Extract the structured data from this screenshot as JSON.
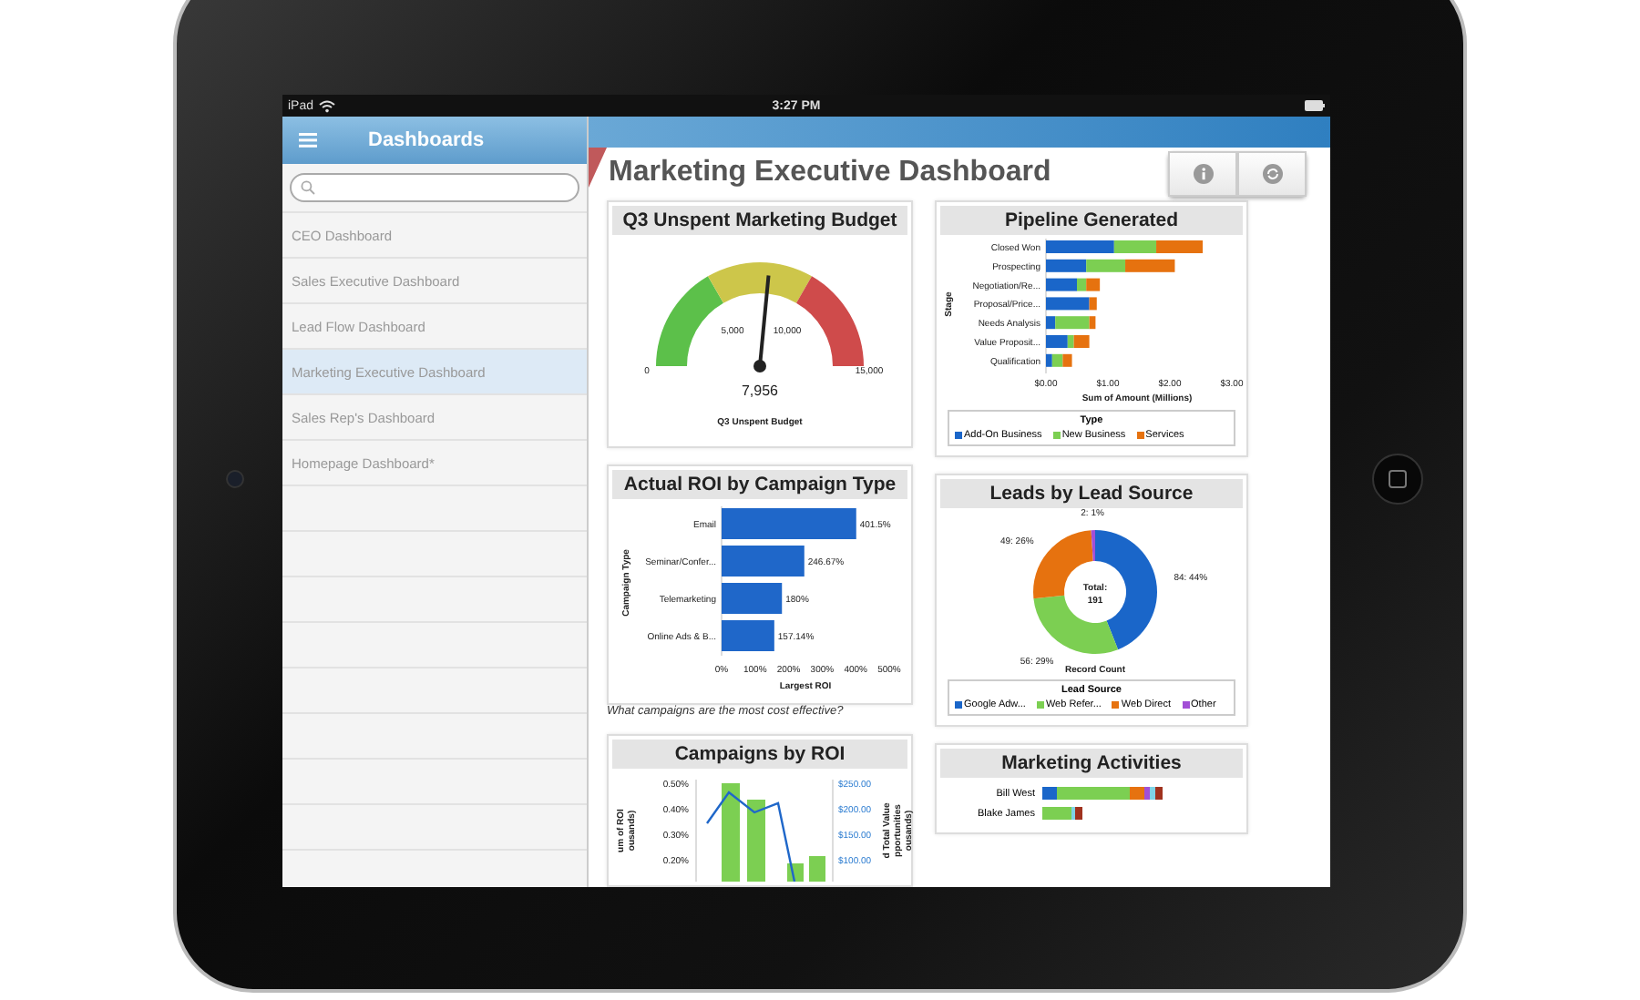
{
  "status_bar": {
    "device": "iPad",
    "time": "3:27 PM"
  },
  "sidebar": {
    "title": "Dashboards",
    "items": [
      {
        "label": "CEO Dashboard",
        "selected": false
      },
      {
        "label": "Sales Executive Dashboard",
        "selected": false
      },
      {
        "label": "Lead Flow Dashboard",
        "selected": false
      },
      {
        "label": "Marketing Executive Dashboard",
        "selected": true
      },
      {
        "label": "Sales Rep's Dashboard",
        "selected": false
      },
      {
        "label": "Homepage Dashboard*",
        "selected": false
      }
    ]
  },
  "dashboard": {
    "title": "Marketing Executive Dashboard"
  },
  "gauge_card": {
    "title": "Q3 Unspent Marketing Budget",
    "ticks": [
      "0",
      "5,000",
      "10,000",
      "15,000"
    ],
    "value": "7,956",
    "level": 0.5304,
    "label": "Q3 Unspent Budget"
  },
  "roi_card": {
    "title": "Actual ROI by Campaign Type",
    "chart_data": {
      "type": "bar",
      "orientation": "horizontal",
      "xlabel": "Largest ROI",
      "ylabel": "Campaign Type",
      "categories": [
        "Email",
        "Seminar/Confer...",
        "Telemarketing",
        "Online Ads & B..."
      ],
      "values": [
        401.5,
        246.67,
        180,
        157.14
      ],
      "value_labels": [
        "401.5%",
        "246.67%",
        "180%",
        "157.14%"
      ],
      "xlim": [
        0,
        500
      ],
      "xticks": [
        {
          "value": 0,
          "label": "0%"
        },
        {
          "value": 100,
          "label": "100%"
        },
        {
          "value": 200,
          "label": "200%"
        },
        {
          "value": 300,
          "label": "300%"
        },
        {
          "value": 400,
          "label": "400%"
        },
        {
          "value": 500,
          "label": "500%"
        }
      ]
    },
    "caption": "What campaigns are the most cost effective?"
  },
  "campaigns_card": {
    "title": "Campaigns by ROI",
    "left_ticks": [
      "0.50%",
      "0.40%",
      "0.30%",
      "0.20%"
    ],
    "right_ticks": [
      "$250.00",
      "$200.00",
      "$150.00",
      "$100.00"
    ],
    "left_axis_label": [
      "um of ROI",
      "ousands)"
    ],
    "right_axis_label": [
      "d Total Value",
      "pportunities",
      "ousands)"
    ]
  },
  "pipeline_card": {
    "title": "Pipeline Generated",
    "chart_data": {
      "type": "bar",
      "orientation": "horizontal",
      "stacked": true,
      "xlabel": "Sum of Amount (Millions)",
      "ylabel": "Stage",
      "categories": [
        "Closed Won",
        "Prospecting",
        "Negotiation/Re...",
        "Proposal/Price...",
        "Needs Analysis",
        "Value Proposit...",
        "Qualification"
      ],
      "series": [
        {
          "name": "Add-On Business",
          "color": "#1a66c9",
          "values": [
            1.1,
            0.65,
            0.5,
            0.7,
            0.15,
            0.35,
            0.1
          ]
        },
        {
          "name": "New Business",
          "color": "#7ccf52",
          "values": [
            0.68,
            0.63,
            0.15,
            0,
            0.55,
            0.1,
            0.17
          ]
        },
        {
          "name": "Services",
          "color": "#e6720f",
          "values": [
            0.75,
            0.8,
            0.22,
            0.12,
            0.1,
            0.25,
            0.15
          ]
        }
      ],
      "xlim": [
        0,
        3
      ],
      "xticks": [
        {
          "value": 0,
          "label": "$0.00"
        },
        {
          "value": 1,
          "label": "$1.00"
        },
        {
          "value": 2,
          "label": "$2.00"
        },
        {
          "value": 3,
          "label": "$3.00"
        }
      ]
    },
    "legend_title": "Type"
  },
  "leads_card": {
    "title": "Leads by Lead Source",
    "chart_data": {
      "type": "donut",
      "xlabel": "Record Count",
      "categories": [
        "Google Adw...",
        "Web Refer...",
        "Web Direct",
        "Other"
      ],
      "values": [
        84,
        56,
        49,
        2
      ],
      "value_labels": [
        "84: 44%",
        "56: 29%",
        "49: 26%",
        "2: 1%"
      ]
    },
    "center_label": "Total:",
    "center_value": "191",
    "legend_title": "Lead Source",
    "legend": [
      {
        "color": "#1a66c9"
      },
      {
        "color": "#7ccf52"
      },
      {
        "color": "#e6720f"
      },
      {
        "color": "#a24fd6"
      }
    ]
  },
  "activities_card": {
    "title": "Marketing Activities",
    "rows": [
      {
        "name": "Bill West"
      },
      {
        "name": "Blake James"
      }
    ]
  }
}
